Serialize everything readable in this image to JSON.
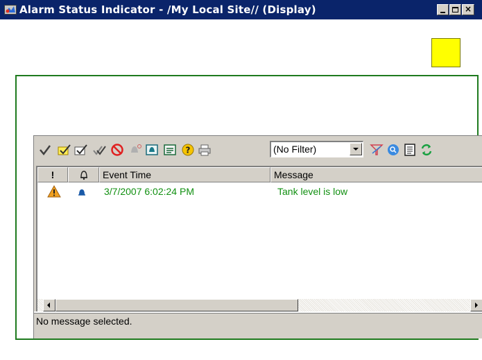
{
  "window": {
    "title": "Alarm Status Indicator - /My Local Site// (Display)",
    "controls": [
      "minimize",
      "maximize",
      "close"
    ],
    "close_glyph": "×"
  },
  "indicator": {
    "color": "#ffff00"
  },
  "toolbar": {
    "icons": [
      "acknowledge-icon",
      "acknowledge-page-icon",
      "acknowledge-selected-icon",
      "acknowledge-all-icon",
      "disable-icon",
      "silence-icon",
      "suppress-icon",
      "details-icon",
      "help-icon",
      "print-icon",
      "filter-icon",
      "find-icon",
      "list-icon",
      "refresh-icon"
    ],
    "filter": {
      "value": "(No Filter)"
    }
  },
  "list": {
    "columns": [
      {
        "id": "severity",
        "label": "!"
      },
      {
        "id": "state",
        "label": "bell-icon"
      },
      {
        "id": "event_time",
        "label": "Event Time"
      },
      {
        "id": "message",
        "label": "Message"
      }
    ],
    "rows": [
      {
        "severity_icon": "warning-icon",
        "state_icon": "bell-icon",
        "event_time": "3/7/2007 6:02:24 PM",
        "message": "Tank level is low"
      }
    ]
  },
  "status": {
    "text": "No message selected."
  },
  "colors": {
    "titlebar": "#0a246a",
    "frame": "#1e7a1e",
    "row_text": "#119011",
    "indicator": "#ffff00"
  }
}
